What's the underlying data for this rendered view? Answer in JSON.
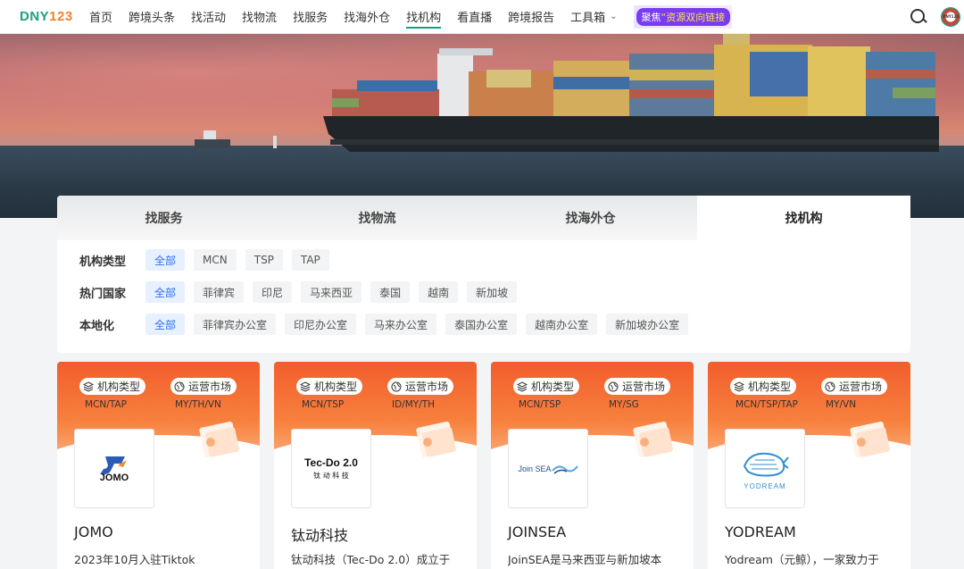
{
  "header": {
    "logo_part1": "DNY",
    "logo_part2": "123",
    "nav": [
      {
        "label": "首页"
      },
      {
        "label": "跨境头条"
      },
      {
        "label": "找活动"
      },
      {
        "label": "找物流"
      },
      {
        "label": "找服务"
      },
      {
        "label": "找海外仓"
      },
      {
        "label": "找机构"
      },
      {
        "label": "看直播"
      },
      {
        "label": "跨境报告"
      },
      {
        "label": "工具箱"
      }
    ],
    "active_nav": "找机构",
    "promo_prefix": "聚焦",
    "promo_highlight": "“资源双向链接",
    "avatar_text": "DNY123"
  },
  "tabs": [
    {
      "label": "找服务"
    },
    {
      "label": "找物流"
    },
    {
      "label": "找海外仓"
    },
    {
      "label": "找机构"
    }
  ],
  "active_tab": "找机构",
  "filters": [
    {
      "label": "机构类型",
      "options": [
        "全部",
        "MCN",
        "TSP",
        "TAP"
      ],
      "selected": "全部"
    },
    {
      "label": "热门国家",
      "options": [
        "全部",
        "菲律宾",
        "印尼",
        "马来西亚",
        "泰国",
        "越南",
        "新加坡"
      ],
      "selected": "全部"
    },
    {
      "label": "本地化",
      "options": [
        "全部",
        "菲律宾办公室",
        "印尼办公室",
        "马来办公室",
        "泰国办公室",
        "越南办公室",
        "新加坡办公室"
      ],
      "selected": "全部"
    }
  ],
  "card_labels": {
    "type": "机构类型",
    "market": "运营市场"
  },
  "cards": [
    {
      "type_value": "MCN/TAP",
      "market_value": "MY/TH/VN",
      "logo_text": "JOMO",
      "name": "JOMO",
      "desc": "2023年10月入驻Tiktok"
    },
    {
      "type_value": "MCN/TSP",
      "market_value": "ID/MY/TH",
      "logo_text": "Tec-Do 2.0",
      "logo_sub": "钛 动 科 技",
      "name": "钛动科技",
      "desc": "钛动科技（Tec-Do 2.0）成立于"
    },
    {
      "type_value": "MCN/TSP",
      "market_value": "MY/SG",
      "logo_text": "Join SEA",
      "name": "JOINSEA",
      "desc": "JoinSEA是马来西亚与新加坡本"
    },
    {
      "type_value": "MCN/TSP/TAP",
      "market_value": "MY/VN",
      "logo_text": "YODREAM",
      "name": "YODREAM",
      "desc": "Yodream（元鲸），一家致力于"
    }
  ],
  "colors": {
    "accent_green": "#14a37a",
    "chip_active": "#2f6ff0",
    "card_orange": "#f25d2d"
  }
}
